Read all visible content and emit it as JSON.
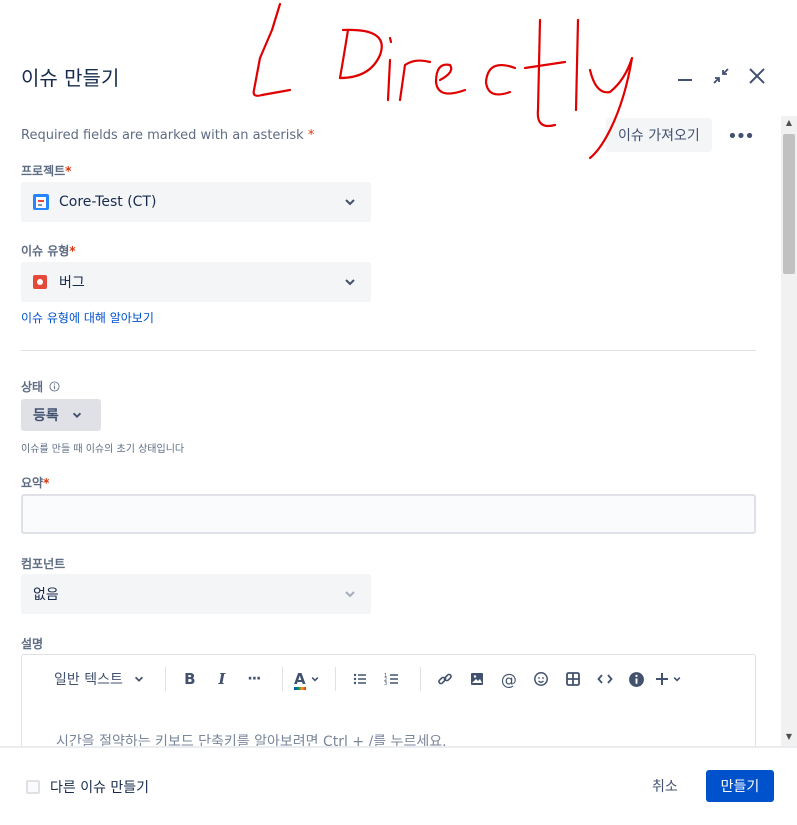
{
  "modal": {
    "title": "이슈 만들기"
  },
  "header": {
    "required_note": "Required fields are marked with an asterisk",
    "required_star": "*",
    "import_label": "이슈 가져오기",
    "more_label": "•••"
  },
  "fields": {
    "project": {
      "label": "프로젝트",
      "value": "Core-Test (CT)"
    },
    "issue_type": {
      "label": "이슈 유형",
      "value": "버그",
      "help_link": "이슈 유형에 대해 알아보기"
    },
    "status": {
      "label": "상태",
      "value": "등록",
      "helper": "이슈를 만들 때 이슈의 초기 상태입니다"
    },
    "summary": {
      "label": "요약",
      "value": ""
    },
    "component": {
      "label": "컴포넌트",
      "value": "없음"
    },
    "description": {
      "label": "설명",
      "text_style": "일반 텍스트",
      "placeholder": "시간을 절약하는 키보드 단축키를 알아보려면 Ctrl + /를 누르세요."
    }
  },
  "footer": {
    "create_another_label": "다른 이슈 만들기",
    "cancel_label": "취소",
    "create_label": "만들기"
  },
  "annotation": {
    "handwritten_text": "Directly"
  },
  "colors": {
    "primary": "#0052cc",
    "required": "#de350b",
    "bug": "#e5493a",
    "annotation": "#e00000"
  },
  "icons": {
    "project": "project-avatar-icon",
    "issue_type": "bug-icon",
    "info": "info-circle-icon"
  }
}
